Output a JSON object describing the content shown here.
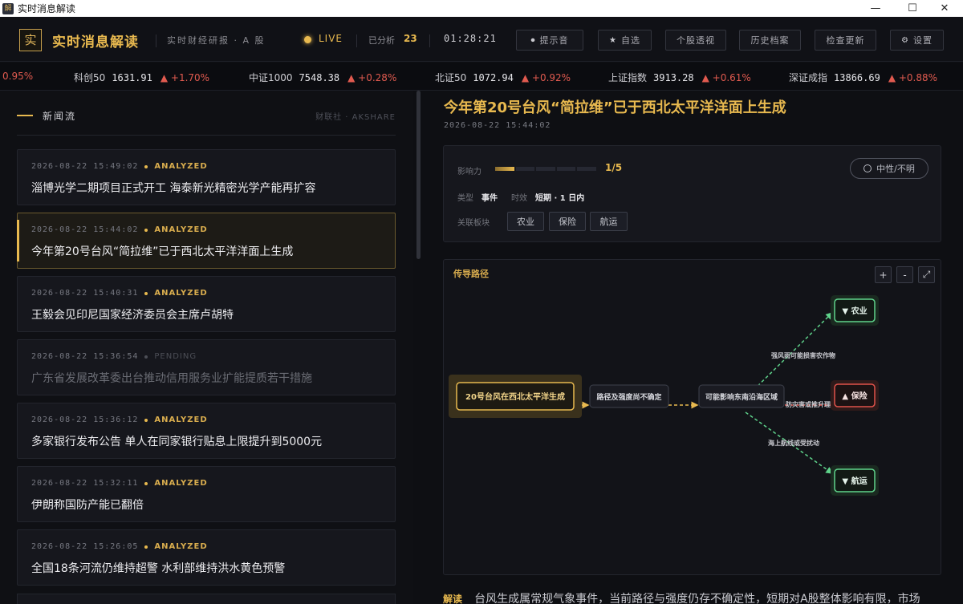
{
  "window": {
    "title": "实时消息解读",
    "controls": [
      "—",
      "☐",
      "✕"
    ]
  },
  "header": {
    "logo_char": "实",
    "brand": "实时消息解读",
    "subtitle": "实时财经研报 · A 股",
    "live": "LIVE",
    "analyzed_label": "已分析",
    "analyzed_count": "23",
    "clock": "01:28:21",
    "buttons": [
      {
        "icon": "⏺",
        "label": "提示音"
      },
      {
        "icon": "★",
        "label": "自选"
      },
      {
        "label": "个股透视"
      },
      {
        "label": "历史档案"
      },
      {
        "label": "检查更新"
      },
      {
        "icon": "⚙",
        "label": "设置"
      }
    ]
  },
  "ticker": [
    {
      "name": "",
      "value": "",
      "change": "0.95%"
    },
    {
      "name": "科创50",
      "value": "1631.91",
      "change": "▲ +1.70%"
    },
    {
      "name": "中证1000",
      "value": "7548.38",
      "change": "▲ +0.28%"
    },
    {
      "name": "北证50",
      "value": "1072.94",
      "change": "▲ +0.92%"
    },
    {
      "name": "上证指数",
      "value": "3913.28",
      "change": "▲ +0.61%"
    },
    {
      "name": "深证成指",
      "value": "13866.69",
      "change": "▲ +0.88%"
    }
  ],
  "feed": {
    "title": "新闻流",
    "source": "财联社 · AKSHARE",
    "items": [
      {
        "time": "2026-08-22 15:49:02",
        "status": "ANALYZED",
        "headline": "淄博光学二期项目正式开工 海泰新光精密光学产能再扩容"
      },
      {
        "time": "2026-08-22 15:44:02",
        "status": "ANALYZED",
        "headline": "今年第20号台风“简拉维”已于西北太平洋洋面上生成"
      },
      {
        "time": "2026-08-22 15:40:31",
        "status": "ANALYZED",
        "headline": "王毅会见印尼国家经济委员会主席卢胡特"
      },
      {
        "time": "2026-08-22 15:36:54",
        "status": "PENDING",
        "headline": "广东省发展改革委出台推动信用服务业扩能提质若干措施"
      },
      {
        "time": "2026-08-22 15:36:12",
        "status": "ANALYZED",
        "headline": "多家银行发布公告 单人在同家银行贴息上限提升到5000元"
      },
      {
        "time": "2026-08-22 15:32:11",
        "status": "ANALYZED",
        "headline": "伊朗称国防产能已翻倍"
      },
      {
        "time": "2026-08-22 15:26:05",
        "status": "ANALYZED",
        "headline": "全国18条河流仍维持超警 水利部维持洪水黄色预警"
      }
    ]
  },
  "article": {
    "title": "今年第20号台风“简拉维”已于西北太平洋洋面上生成",
    "time": "2026-08-22 15:44:02",
    "impact_label": "影响力",
    "impact_level": 1,
    "impact_max": 5,
    "impact_text": "1/5",
    "type_label": "类型",
    "type_value": "事件",
    "duration_label": "时效",
    "duration_value": "短期 · 1 日内",
    "sectors_label": "关联板块",
    "sectors": [
      "农业",
      "保险",
      "航运"
    ],
    "sentiment": "中性/不明"
  },
  "graph": {
    "title": "传导路径",
    "controls": [
      "+",
      "-",
      "⤢"
    ],
    "nodes": {
      "source": "20号台风在西北太平洋生成",
      "mid1": "路径及强度尚不确定",
      "mid2": "可能影响东南沿海区域",
      "out1": "▼ 农业",
      "out2": "▲ 保险",
      "out3": "▼ 航运"
    },
    "edges": {
      "e1": "强风雨可能损害农作物",
      "e2": "防灾害或推升理赔",
      "e3": "海上航线或受扰动"
    },
    "colors": {
      "gold": "#e8b94f",
      "green": "#5fd38b",
      "red": "#e0524b"
    }
  },
  "note": {
    "label": "解读",
    "text": "台风生成属常规气象事件，当前路径与强度仍存不确定性，短期对A股整体影响有限，市场"
  }
}
